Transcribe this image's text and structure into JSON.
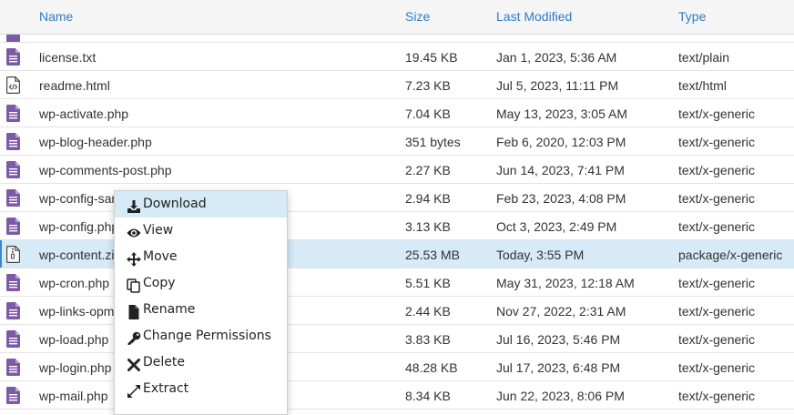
{
  "table": {
    "headers": {
      "name": "Name",
      "size": "Size",
      "modified": "Last Modified",
      "type": "Type"
    },
    "rows": [
      {
        "name": "license.txt",
        "size": "19.45 KB",
        "modified": "Jan 1, 2023, 5:36 AM",
        "type": "text/plain",
        "icon": "text-file-icon"
      },
      {
        "name": "readme.html",
        "size": "7.23 KB",
        "modified": "Jul 5, 2023, 11:11 PM",
        "type": "text/html",
        "icon": "html-file-icon"
      },
      {
        "name": "wp-activate.php",
        "size": "7.04 KB",
        "modified": "May 13, 2023, 3:05 AM",
        "type": "text/x-generic",
        "icon": "text-file-icon"
      },
      {
        "name": "wp-blog-header.php",
        "size": "351 bytes",
        "modified": "Feb 6, 2020, 12:03 PM",
        "type": "text/x-generic",
        "icon": "text-file-icon"
      },
      {
        "name": "wp-comments-post.php",
        "size": "2.27 KB",
        "modified": "Jun 14, 2023, 7:41 PM",
        "type": "text/x-generic",
        "icon": "text-file-icon"
      },
      {
        "name": "wp-config-sar",
        "size": "2.94 KB",
        "modified": "Feb 23, 2023, 4:08 PM",
        "type": "text/x-generic",
        "icon": "text-file-icon"
      },
      {
        "name": "wp-config.php",
        "size": "3.13 KB",
        "modified": "Oct 3, 2023, 2:49 PM",
        "type": "text/x-generic",
        "icon": "text-file-icon"
      },
      {
        "name": "wp-content.zi",
        "size": "25.53 MB",
        "modified": "Today, 3:55 PM",
        "type": "package/x-generic",
        "icon": "zip-file-icon",
        "selected": true
      },
      {
        "name": "wp-cron.php",
        "size": "5.51 KB",
        "modified": "May 31, 2023, 12:18 AM",
        "type": "text/x-generic",
        "icon": "text-file-icon"
      },
      {
        "name": "wp-links-opm",
        "size": "2.44 KB",
        "modified": "Nov 27, 2022, 2:31 AM",
        "type": "text/x-generic",
        "icon": "text-file-icon"
      },
      {
        "name": "wp-load.php",
        "size": "3.83 KB",
        "modified": "Jul 16, 2023, 5:46 PM",
        "type": "text/x-generic",
        "icon": "text-file-icon"
      },
      {
        "name": "wp-login.php",
        "size": "48.28 KB",
        "modified": "Jul 17, 2023, 6:48 PM",
        "type": "text/x-generic",
        "icon": "text-file-icon"
      },
      {
        "name": "wp-mail.php",
        "size": "8.34 KB",
        "modified": "Jun 22, 2023, 8:06 PM",
        "type": "text/x-generic",
        "icon": "text-file-icon"
      }
    ]
  },
  "context_menu": {
    "items": [
      {
        "label": "Download",
        "icon": "download-icon"
      },
      {
        "label": "View",
        "icon": "eye-icon"
      },
      {
        "label": "Move",
        "icon": "move-arrows-icon"
      },
      {
        "label": "Copy",
        "icon": "copy-icon"
      },
      {
        "label": "Rename",
        "icon": "file-icon"
      },
      {
        "label": "Change Permissions",
        "icon": "key-icon"
      },
      {
        "label": "Delete",
        "icon": "x-icon"
      },
      {
        "label": "Extract",
        "icon": "expand-arrows-icon"
      }
    ]
  },
  "colors": {
    "header_text": "#2f7bc4",
    "file_icon": "#7d5aa5",
    "selection": "#d6eaf8"
  }
}
